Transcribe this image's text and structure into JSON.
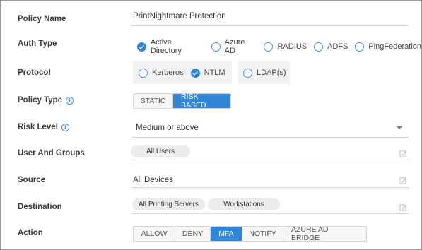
{
  "policy_name": {
    "label": "Policy Name",
    "value": "PrintNightmare Protection"
  },
  "auth_type": {
    "label": "Auth Type",
    "options": [
      {
        "label": "Active Directory",
        "checked": true
      },
      {
        "label": "Azure AD",
        "checked": false
      },
      {
        "label": "RADIUS",
        "checked": false
      },
      {
        "label": "ADFS",
        "checked": false
      },
      {
        "label": "PingFederation",
        "checked": false
      }
    ]
  },
  "protocol": {
    "label": "Protocol",
    "options": [
      {
        "label": "Kerberos",
        "checked": false
      },
      {
        "label": "NTLM",
        "checked": true
      },
      {
        "label": "LDAP(s)",
        "checked": false
      }
    ]
  },
  "policy_type": {
    "label": "Policy Type",
    "info_icon": "info-icon",
    "options": [
      "STATIC",
      "RISK BASED"
    ],
    "selected": "RISK BASED"
  },
  "risk_level": {
    "label": "Risk Level",
    "info_icon": "info-icon",
    "value": "Medium or above",
    "caret_icon": "chevron-down-icon"
  },
  "user_groups": {
    "label": "User And Groups",
    "chips": [
      "All Users"
    ],
    "edit_icon": "edit-icon"
  },
  "source": {
    "label": "Source",
    "value": "All Devices",
    "edit_icon": "edit-icon"
  },
  "destination": {
    "label": "Destination",
    "chips": [
      "All Printing Servers",
      "Workstations"
    ],
    "edit_icon": "edit-icon"
  },
  "action": {
    "label": "Action",
    "options": [
      "ALLOW",
      "DENY",
      "MFA",
      "NOTIFY",
      "AZURE AD BRIDGE"
    ],
    "selected": "MFA"
  },
  "colors": {
    "accent": "#2f86d6",
    "chip_bg": "#ececec",
    "underline": "#d6d6d6"
  }
}
